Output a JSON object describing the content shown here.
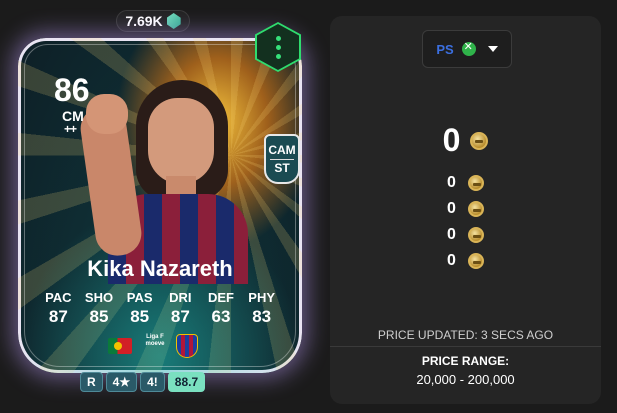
{
  "price_badge": {
    "value": "7.69K",
    "icon": "gem-icon"
  },
  "card": {
    "rating": "86",
    "position": "CM",
    "position_plus": "++",
    "alt_positions": [
      "CAM",
      "ST"
    ],
    "name": "Kika Nazareth",
    "stats": [
      {
        "label": "PAC",
        "value": "87"
      },
      {
        "label": "SHO",
        "value": "85"
      },
      {
        "label": "PAS",
        "value": "85"
      },
      {
        "label": "DRI",
        "value": "87"
      },
      {
        "label": "DEF",
        "value": "63"
      },
      {
        "label": "PHY",
        "value": "83"
      }
    ],
    "nation": "Portugal",
    "league": "Liga F moeve",
    "club": "FC Barcelona"
  },
  "attributes": {
    "foot": "R",
    "skill_moves": "4★",
    "weak_foot": "4!",
    "rating": "88.7"
  },
  "menu": {
    "icon": "more-vertical-icon"
  },
  "panel": {
    "platform": {
      "label_ps": "PS",
      "label_xbox": "XB"
    },
    "main_price": "0",
    "sub_prices": [
      "0",
      "0",
      "0",
      "0"
    ],
    "updated": "PRICE UPDATED: 3 SECS AGO",
    "range_label": "PRICE RANGE:",
    "range_value": "20,000 - 200,000"
  },
  "colors": {
    "accent": "#2fdc6e",
    "coin": "#d9b457",
    "panel_bg": "#252525"
  }
}
